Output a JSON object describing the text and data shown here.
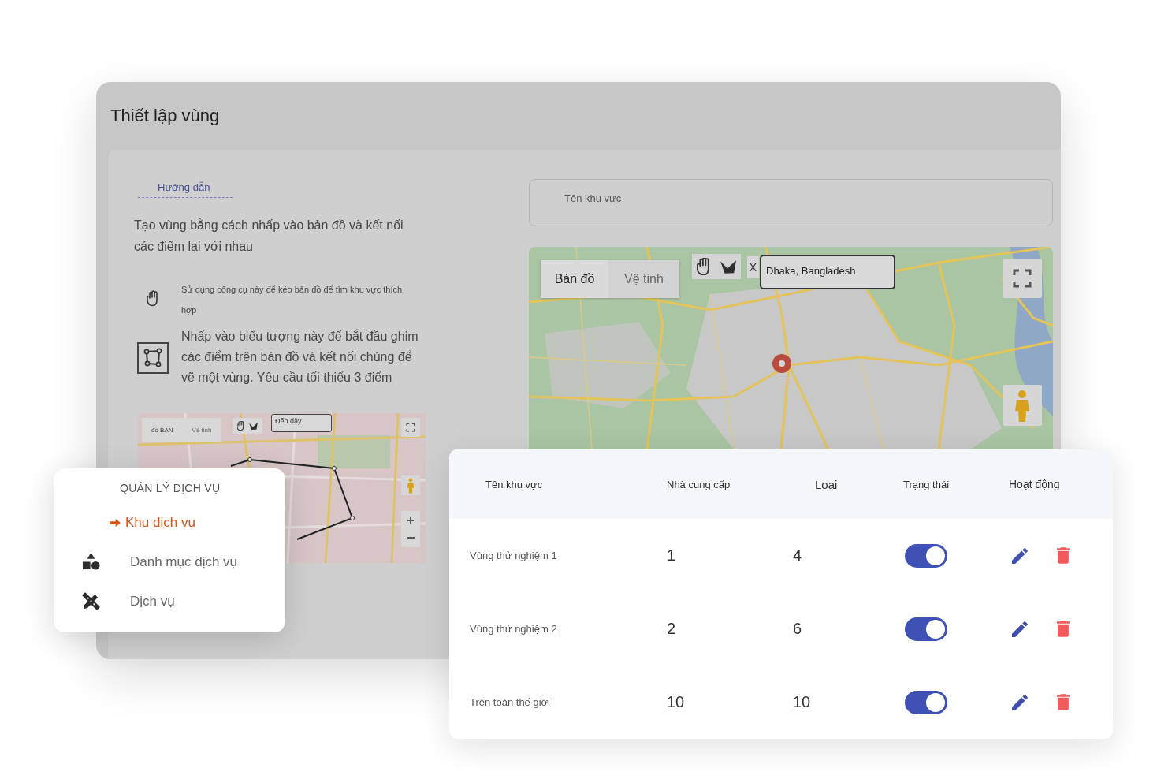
{
  "page": {
    "title": "Thiết lập vùng"
  },
  "guide": {
    "tab": "Hướng dẫn",
    "intro": "Tạo vùng bằng cách nhấp vào bản đồ và kết nối các điểm lại với nhau",
    "steps": [
      {
        "kind": "pan",
        "text": "Sử dụng công cụ này để kéo bản đồ để tìm khu vực thích hợp"
      },
      {
        "kind": "draw",
        "text": "Nhấp vào biểu tượng này để bắt đầu ghim các điểm trên bản đồ và kết nối chúng để vẽ một vùng. Yêu cầu tối thiểu 3 điểm"
      }
    ],
    "preview_map": {
      "map_types": [
        {
          "label": "đồ BẠN",
          "selected": true
        },
        {
          "label": "Vệ tinh",
          "selected": false
        }
      ],
      "search": {
        "value": "Đến đây"
      }
    }
  },
  "area_name_field": {
    "placeholder": "Tên khu vực"
  },
  "map": {
    "map_types": [
      {
        "label": "Bản đồ",
        "selected": true
      },
      {
        "label": "Vệ tinh",
        "selected": false
      }
    ],
    "clear_button": "X",
    "search": {
      "value": "Dhaka, Bangladesh"
    }
  },
  "table": {
    "columns": [
      "Tên khu vực",
      "Nhà cung cấp",
      "Loại",
      "Trạng thái",
      "Hoạt động"
    ],
    "rows": [
      {
        "name": "Vùng thử nghiệm 1",
        "providers": "1",
        "type": "4",
        "active": true
      },
      {
        "name": "Vùng thử nghiệm 2",
        "providers": "2",
        "type": "6",
        "active": true
      },
      {
        "name": "Trên toàn thế giới",
        "providers": "10",
        "type": "10",
        "active": true
      }
    ]
  },
  "sidebar": {
    "heading": "QUẢN LÝ DỊCH VỤ",
    "items": [
      {
        "label": "Khu dịch vụ",
        "selected": true
      },
      {
        "label": "Danh mục dịch vụ",
        "selected": false
      },
      {
        "label": "Dịch vụ",
        "selected": false
      }
    ]
  }
}
